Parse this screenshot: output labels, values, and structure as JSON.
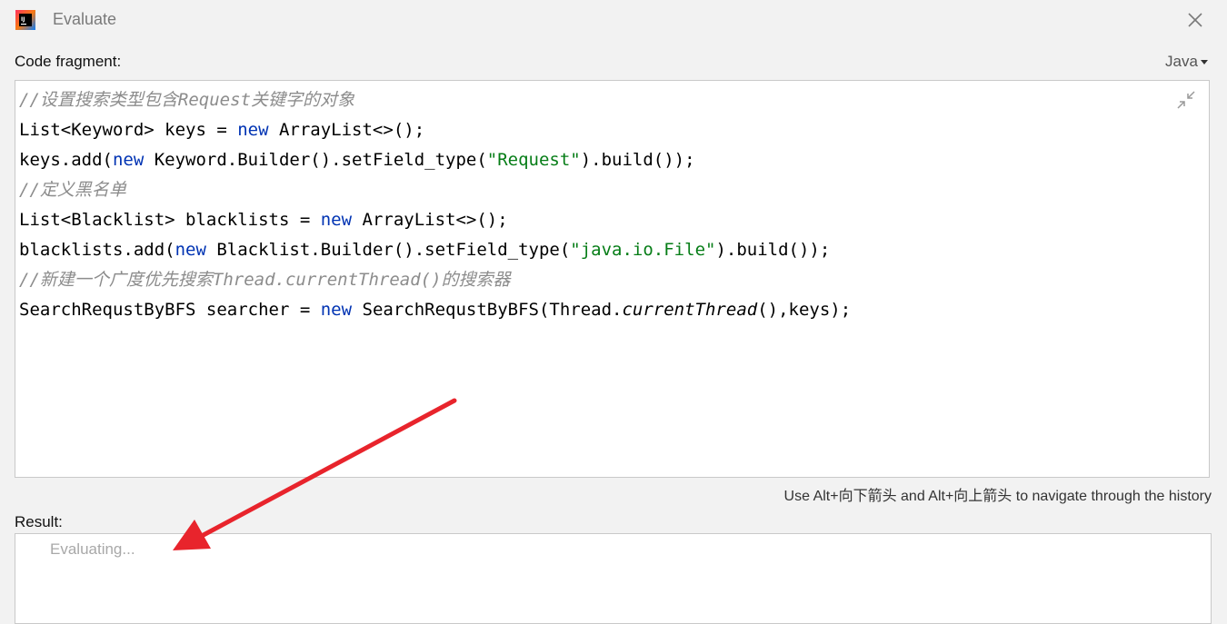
{
  "window": {
    "title": "Evaluate",
    "app_icon": "intellij-idea-icon",
    "close_icon": "close-icon"
  },
  "code_fragment": {
    "label": "Code fragment:",
    "language": "Java",
    "collapse_icon": "collapse-icon",
    "lines": [
      [
        {
          "t": "//设置搜索类型包含Request关键字的对象",
          "c": "cmt"
        }
      ],
      [
        {
          "t": "List<Keyword> keys = ",
          "c": ""
        },
        {
          "t": "new",
          "c": "kw"
        },
        {
          "t": " ArrayList<>();",
          "c": ""
        }
      ],
      [
        {
          "t": "keys.add(",
          "c": ""
        },
        {
          "t": "new",
          "c": "kw"
        },
        {
          "t": " Keyword.Builder().setField_type(",
          "c": ""
        },
        {
          "t": "\"Request\"",
          "c": "str"
        },
        {
          "t": ").build());",
          "c": ""
        }
      ],
      [
        {
          "t": "//定义黑名单",
          "c": "cmt"
        }
      ],
      [
        {
          "t": "List<Blacklist> blacklists = ",
          "c": ""
        },
        {
          "t": "new",
          "c": "kw"
        },
        {
          "t": " ArrayList<>();",
          "c": ""
        }
      ],
      [
        {
          "t": "blacklists.add(",
          "c": ""
        },
        {
          "t": "new",
          "c": "kw"
        },
        {
          "t": " Blacklist.Builder().setField_type(",
          "c": ""
        },
        {
          "t": "\"java.io.File\"",
          "c": "str"
        },
        {
          "t": ").build());",
          "c": ""
        }
      ],
      [
        {
          "t": "//新建一个广度优先搜索Thread.currentThread()的搜索器",
          "c": "cmt"
        }
      ],
      [
        {
          "t": "SearchRequstByBFS searcher = ",
          "c": ""
        },
        {
          "t": "new",
          "c": "kw"
        },
        {
          "t": " SearchRequstByBFS(Thread.",
          "c": ""
        },
        {
          "t": "currentThread",
          "c": "it"
        },
        {
          "t": "(),keys);",
          "c": ""
        }
      ]
    ]
  },
  "history_hint": "Use Alt+向下箭头 and Alt+向上箭头 to navigate through the history",
  "result": {
    "label": "Result:",
    "status": "Evaluating..."
  },
  "annotation": {
    "arrow_icon": "red-arrow-annotation",
    "color": "#e8242c"
  }
}
